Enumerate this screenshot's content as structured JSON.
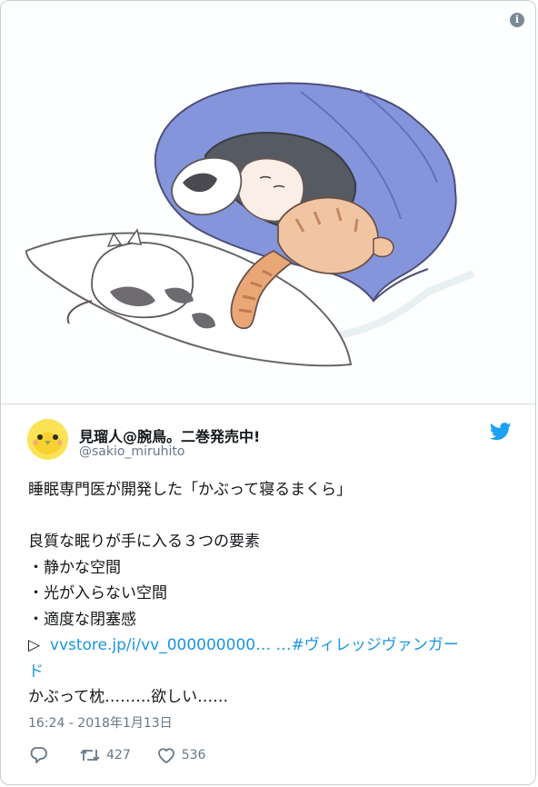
{
  "tweet": {
    "display_name": "見瑠人@腕鳥。二巻発売中!",
    "handle": "@sakio_miruhito",
    "text_lines": [
      "睡眠専門医が開発した「かぶって寝るまくら」",
      "",
      "良質な眠りが手に入る３つの要素",
      "・静かな空間",
      "・光が入らない空間",
      "・適度な閉塞感"
    ],
    "link_prefix": "▷",
    "link_url": "vvstore.jp/i/vv_000000000…",
    "hashtag_part1": "…#ヴィレッジヴァンガー",
    "hashtag_part2": "ド",
    "last_line": "かぶって枕………欲しい……",
    "timestamp": "16:24 - 2018年1月13日",
    "retweet_count": "427",
    "like_count": "536"
  },
  "icons": {
    "info": "info-icon",
    "twitter": "twitter-bird-icon",
    "reply": "reply-icon",
    "retweet": "retweet-icon",
    "like": "heart-icon"
  },
  "colors": {
    "link": "#1b95e0",
    "secondary_text": "#657786",
    "pillow_blue": "#7f8fd8",
    "avatar_yellow": "#fbe357"
  }
}
